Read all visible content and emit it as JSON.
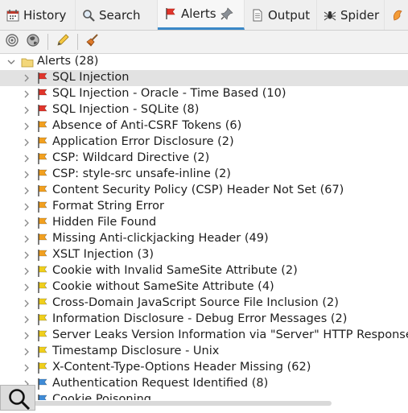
{
  "tabs": [
    {
      "label": "History",
      "icon": "history-icon"
    },
    {
      "label": "Search",
      "icon": "search-icon"
    },
    {
      "label": "Alerts",
      "icon": "alerts-flag-icon",
      "active": true
    },
    {
      "label": "Output",
      "icon": "output-icon"
    },
    {
      "label": "Spider",
      "icon": "spider-icon"
    },
    {
      "label": "",
      "icon": "ajax-spider-icon"
    }
  ],
  "toolbar": [
    "filter-icon",
    "scope-icon",
    "edit-icon",
    "broom-icon"
  ],
  "tree": {
    "root": "Alerts (28)",
    "items": [
      {
        "label": "SQL Injection",
        "risk": "high"
      },
      {
        "label": "SQL Injection - Oracle - Time Based (10)",
        "risk": "high"
      },
      {
        "label": "SQL Injection - SQLite (8)",
        "risk": "high"
      },
      {
        "label": "Absence of Anti-CSRF Tokens (6)",
        "risk": "medium"
      },
      {
        "label": "Application Error Disclosure (2)",
        "risk": "medium"
      },
      {
        "label": "CSP: Wildcard Directive (2)",
        "risk": "medium"
      },
      {
        "label": "CSP: style-src unsafe-inline (2)",
        "risk": "medium"
      },
      {
        "label": "Content Security Policy (CSP) Header Not Set (67)",
        "risk": "medium"
      },
      {
        "label": "Format String Error",
        "risk": "medium"
      },
      {
        "label": "Hidden File Found",
        "risk": "medium"
      },
      {
        "label": "Missing Anti-clickjacking Header (49)",
        "risk": "medium"
      },
      {
        "label": "XSLT Injection (3)",
        "risk": "medium"
      },
      {
        "label": "Cookie with Invalid SameSite Attribute (2)",
        "risk": "low"
      },
      {
        "label": "Cookie without SameSite Attribute (4)",
        "risk": "low"
      },
      {
        "label": "Cross-Domain JavaScript Source File Inclusion (2)",
        "risk": "low"
      },
      {
        "label": "Information Disclosure - Debug Error Messages (2)",
        "risk": "low"
      },
      {
        "label": "Server Leaks Version Information via \"Server\" HTTP Response",
        "risk": "low"
      },
      {
        "label": "Timestamp Disclosure - Unix",
        "risk": "low"
      },
      {
        "label": "X-Content-Type-Options Header Missing (62)",
        "risk": "low"
      },
      {
        "label": "Authentication Request Identified (8)",
        "risk": "info"
      },
      {
        "label": "Cookie Poisoning",
        "risk": "info"
      }
    ]
  },
  "colors": {
    "high": "#e0352b",
    "medium": "#f2a01f",
    "low": "#f0cf1c",
    "info": "#3f8bd6",
    "accent": "#3b88c7"
  }
}
